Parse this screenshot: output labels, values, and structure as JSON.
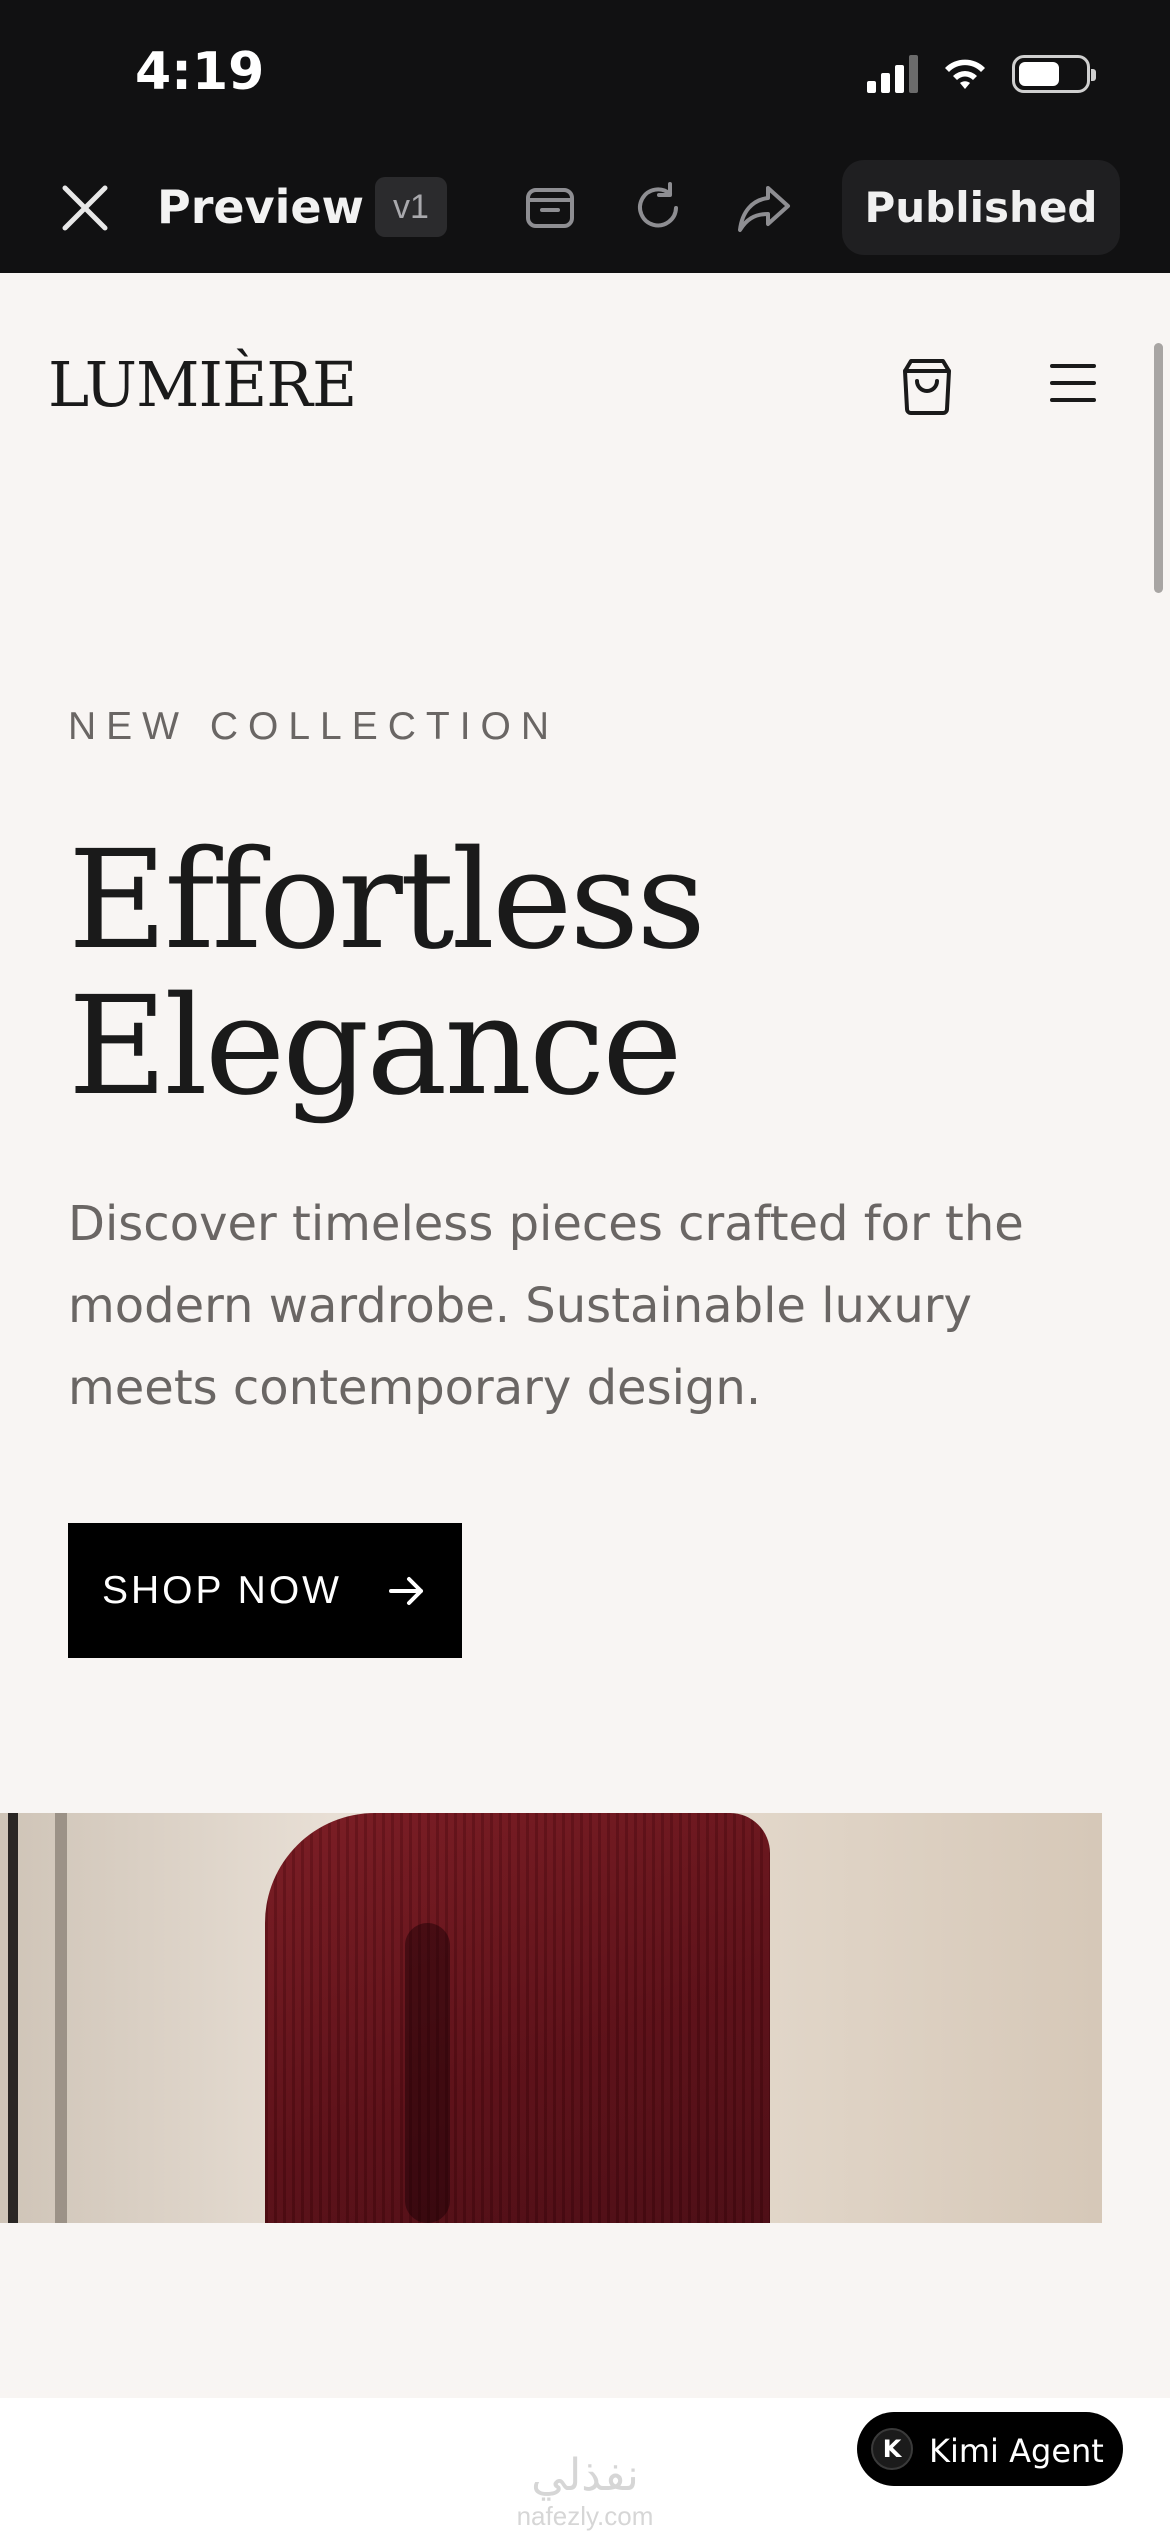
{
  "status_bar": {
    "time": "4:19"
  },
  "toolbar": {
    "title": "Preview",
    "version": "v1",
    "publish_label": "Published"
  },
  "site": {
    "logo": "LUMIÈRE",
    "hero": {
      "eyebrow": "NEW COLLECTION",
      "title_line1": "Effortless",
      "title_line2": "Elegance",
      "description": "Discover timeless pieces crafted for the modern wardrobe. Sustainable luxury meets contemporary design.",
      "cta_label": "SHOP NOW"
    }
  },
  "watermark": {
    "arabic": "نفذلي",
    "latin": "nafezly.com"
  },
  "assistant": {
    "badge_letter": "K",
    "label": "Kimi Agent"
  },
  "colors": {
    "bar_bg": "#111112",
    "page_bg": "#f8f5f3",
    "text_dark": "#1a1a1a",
    "text_muted": "#6a6664",
    "cta_bg": "#000000",
    "sweater": "#6b141c"
  }
}
